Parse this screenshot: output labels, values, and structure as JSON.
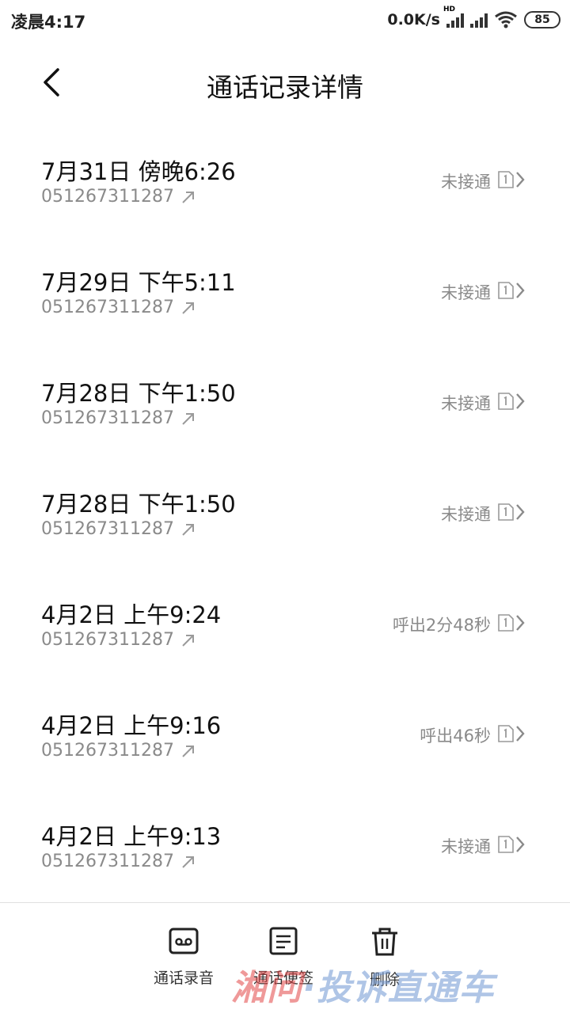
{
  "status_bar": {
    "time": "凌晨4:17",
    "speed": "0.0K/s",
    "hd": "HD",
    "battery": "85"
  },
  "header": {
    "title": "通话记录详情",
    "back_icon": "chevron-left-icon"
  },
  "calls": [
    {
      "date": "7月31日 傍晚6:26",
      "number": "051267311287",
      "status": "未接通"
    },
    {
      "date": "7月29日 下午5:11",
      "number": "051267311287",
      "status": "未接通"
    },
    {
      "date": "7月28日 下午1:50",
      "number": "051267311287",
      "status": "未接通"
    },
    {
      "date": "7月28日 下午1:50",
      "number": "051267311287",
      "status": "未接通"
    },
    {
      "date": "4月2日 上午9:24",
      "number": "051267311287",
      "status": "呼出2分48秒"
    },
    {
      "date": "4月2日 上午9:16",
      "number": "051267311287",
      "status": "呼出46秒"
    },
    {
      "date": "4月2日 上午9:13",
      "number": "051267311287",
      "status": "未接通"
    }
  ],
  "toolbar": {
    "record_label": "通话录音",
    "note_label": "通话便签",
    "delete_label": "删除"
  },
  "watermark": {
    "part1": "湘问",
    "part2": "·投诉直通车"
  },
  "colors": {
    "text_primary": "#111111",
    "text_secondary": "#8a8a8a",
    "divider": "#e0e0e0"
  }
}
